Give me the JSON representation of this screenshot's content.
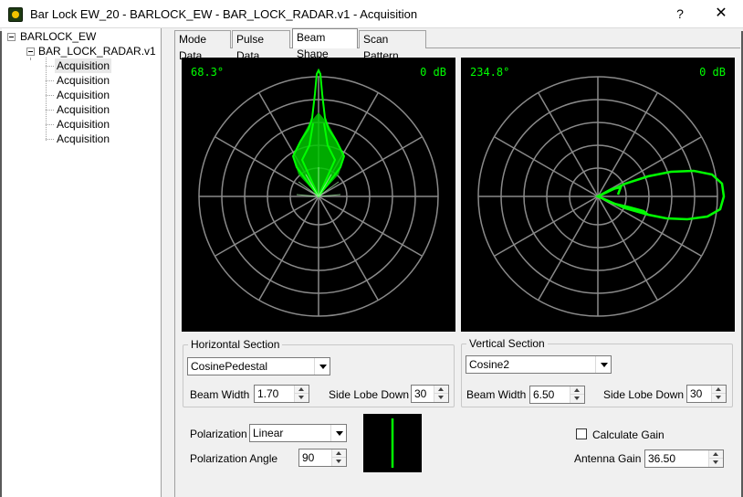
{
  "window": {
    "title": "Bar Lock EW_20 - BARLOCK_EW - BAR_LOCK_RADAR.v1 - Acquisition",
    "help_glyph": "?",
    "close_glyph": "✕",
    "icon": "app-icon"
  },
  "tree": {
    "root": "BARLOCK_EW",
    "child": "BAR_LOCK_RADAR.v1",
    "items": [
      "Acquisition",
      "Acquisition",
      "Acquisition",
      "Acquisition",
      "Acquisition",
      "Acquisition"
    ],
    "selected_index": 0
  },
  "tabs": [
    "Mode Data",
    "Pulse Data",
    "Beam Shape",
    "Scan Pattern"
  ],
  "active_tab": "Beam Shape",
  "scopes": {
    "horizontal": {
      "angle": "68.3°",
      "gain": "0 dB"
    },
    "vertical": {
      "angle": "234.8°",
      "gain": "0 dB"
    },
    "trace_color": "#00ff00",
    "grid_color": "#8a8a8a",
    "background": "#000000"
  },
  "horizontal_section": {
    "title": "Horizontal Section",
    "shape": "CosinePedestal",
    "beam_width_label": "Beam Width",
    "beam_width": "1.70",
    "side_lobe_label": "Side Lobe Down",
    "side_lobe": "30"
  },
  "vertical_section": {
    "title": "Vertical Section",
    "shape": "Cosine2",
    "beam_width_label": "Beam Width",
    "beam_width": "6.50",
    "side_lobe_label": "Side Lobe Down",
    "side_lobe": "30"
  },
  "polarization": {
    "label": "Polarization",
    "value": "Linear",
    "angle_label": "Polarization Angle",
    "angle": "90"
  },
  "gain": {
    "calculate_label": "Calculate Gain",
    "calculate_checked": false,
    "antenna_label": "Antenna Gain",
    "antenna_value": "36.50"
  }
}
